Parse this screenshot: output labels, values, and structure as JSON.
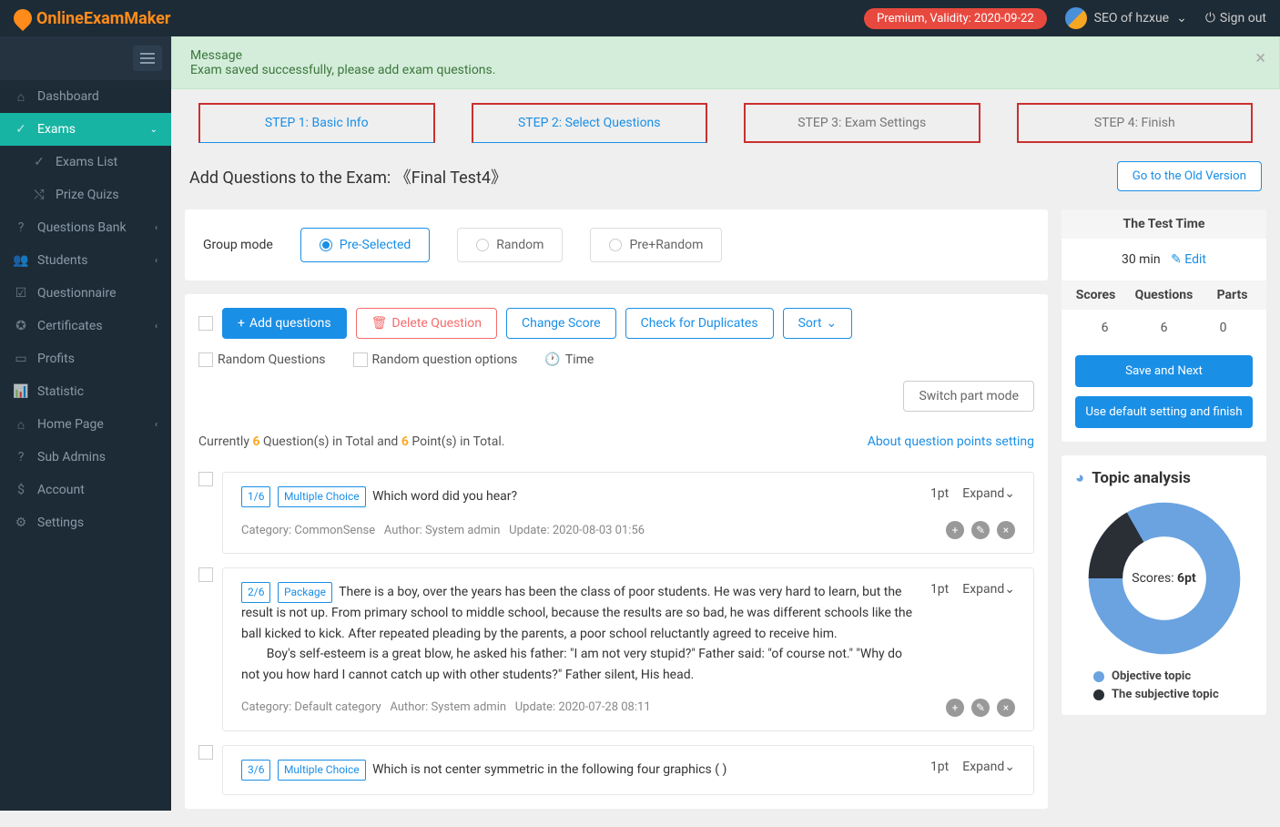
{
  "header": {
    "logo": "OnlineExamMaker",
    "premium": "Premium, Validity: 2020-09-22",
    "user": "SEO of hzxue",
    "signout": "Sign out"
  },
  "sidebar": {
    "items": [
      {
        "label": "Dashboard",
        "icon": "home"
      },
      {
        "label": "Exams",
        "icon": "check",
        "active": true,
        "expanded": true
      },
      {
        "label": "Exams List",
        "icon": "check",
        "sub": true
      },
      {
        "label": "Prize Quizs",
        "icon": "shuffle",
        "sub": true
      },
      {
        "label": "Questions Bank",
        "icon": "help",
        "chevron": true
      },
      {
        "label": "Students",
        "icon": "users",
        "chevron": true
      },
      {
        "label": "Questionnaire",
        "icon": "check-square"
      },
      {
        "label": "Certificates",
        "icon": "certificate",
        "chevron": true
      },
      {
        "label": "Profits",
        "icon": "card"
      },
      {
        "label": "Statistic",
        "icon": "chart"
      },
      {
        "label": "Home Page",
        "icon": "home",
        "chevron": true
      },
      {
        "label": "Sub Admins",
        "icon": "help"
      },
      {
        "label": "Account",
        "icon": "dollar"
      },
      {
        "label": "Settings",
        "icon": "gear"
      }
    ]
  },
  "message": {
    "title": "Message",
    "body": "Exam saved successfully, please add exam questions."
  },
  "steps": [
    {
      "label": "STEP 1: Basic Info",
      "active": true
    },
    {
      "label": "STEP 2: Select Questions",
      "active": true
    },
    {
      "label": "STEP 3: Exam Settings"
    },
    {
      "label": "STEP 4: Finish"
    }
  ],
  "page": {
    "title_prefix": "Add Questions to the Exam:",
    "title_name": "《Final Test4》",
    "old_version": "Go to the Old Version"
  },
  "group_mode": {
    "label": "Group mode",
    "options": [
      "Pre-Selected",
      "Random",
      "Pre+Random"
    ],
    "selected": 0
  },
  "toolbar": {
    "add": "Add questions",
    "delete": "Delete Question",
    "change_score": "Change Score",
    "check_dup": "Check for Duplicates",
    "sort": "Sort",
    "random_q": "Random Questions",
    "random_opt": "Random question options",
    "time": "Time",
    "switch_mode": "Switch part mode"
  },
  "summary": {
    "prefix": "Currently ",
    "q_count": "6",
    "mid": " Question(s) in Total and ",
    "p_count": "6",
    "suffix": " Point(s) in Total.",
    "about_link": "About question points setting"
  },
  "questions": [
    {
      "num": "1/6",
      "type": "Multiple Choice",
      "text": "Which word did you hear?",
      "pts": "1pt",
      "expand": "Expand",
      "category": "Category: CommonSense",
      "author": "Author: System admin",
      "update": "Update: 2020-08-03 01:56"
    },
    {
      "num": "2/6",
      "type": "Package",
      "text": "There is a boy, over the years has been the class of poor students. He was very hard to learn, but the result is not up. From primary school to middle school, because the results are so bad, he was different schools like the ball kicked to kick. After repeated pleading by the parents, a poor school reluctantly agreed to receive him.\n        Boy's self-esteem is a great blow, he asked his father: \"I am not very stupid?\" Father said: \"of course not.\" \"Why do not you how hard I cannot catch up with other students?\" Father silent, His head.",
      "pts": "1pt",
      "expand": "Expand",
      "category": "Category: Default category",
      "author": "Author: System admin",
      "update": "Update: 2020-07-28 08:11"
    },
    {
      "num": "3/6",
      "type": "Multiple Choice",
      "text": "Which is not center symmetric in the following four graphics (   )",
      "pts": "1pt",
      "expand": "Expand"
    }
  ],
  "test_time": {
    "title": "The Test Time",
    "value": "30 min",
    "edit": "Edit",
    "headers": [
      "Scores",
      "Questions",
      "Parts"
    ],
    "values": [
      "6",
      "6",
      "0"
    ],
    "save_next": "Save and Next",
    "use_default": "Use default setting and finish"
  },
  "topic": {
    "title": "Topic analysis",
    "center_label": "Scores:",
    "center_value": "6pt",
    "legend": [
      {
        "label": "Objective topic",
        "color": "#6aa3e0"
      },
      {
        "label": "The subjective topic",
        "color": "#2a2f36"
      }
    ]
  },
  "chart_data": {
    "type": "pie",
    "title": "Topic analysis",
    "series": [
      {
        "name": "Objective topic",
        "value": 5,
        "color": "#6aa3e0"
      },
      {
        "name": "The subjective topic",
        "value": 1,
        "color": "#2a2f36"
      }
    ],
    "center_label": "Scores: 6pt"
  }
}
